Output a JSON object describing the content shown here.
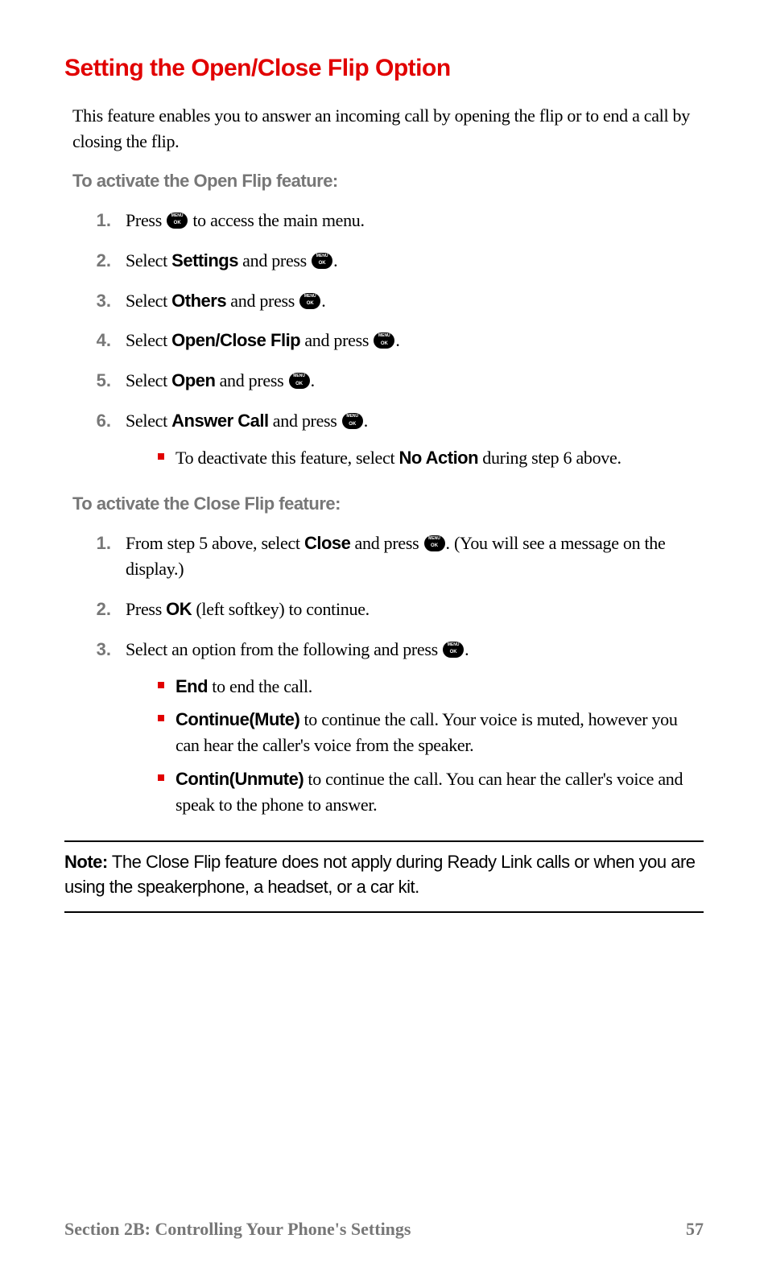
{
  "heading": "Setting the Open/Close Flip Option",
  "intro": "This feature enables you to answer an incoming call by opening the flip or to end a call by closing the flip.",
  "sub1": "To activate the Open Flip feature:",
  "steps1": {
    "s1_a": "Press ",
    "s1_b": " to access the main menu.",
    "s2_a": "Select ",
    "s2_sel": "Settings",
    "s2_b": " and press ",
    "s3_a": "Select ",
    "s3_sel": "Others",
    "s3_b": " and press ",
    "s4_a": "Select ",
    "s4_sel": "Open/Close Flip",
    "s4_b": " and press ",
    "s5_a": "Select ",
    "s5_sel": "Open",
    "s5_b": " and press ",
    "s6_a": "Select ",
    "s6_sel": "Answer Call",
    "s6_b": " and press ",
    "s6_bullet_a": "To deactivate this feature, select ",
    "s6_bullet_sel": "No Action",
    "s6_bullet_b": " during step 6 above."
  },
  "sub2": "To activate the Close Flip feature:",
  "steps2": {
    "s1_a": "From step 5 above, select ",
    "s1_sel": "Close",
    "s1_b": " and press ",
    "s1_c": ". (You will see a message on the display.)",
    "s2_a": "Press ",
    "s2_sel": "OK",
    "s2_b": " (left softkey) to continue.",
    "s3_a": "Select an option from the following and press ",
    "b1_sel": "End",
    "b1_txt": " to end the call.",
    "b2_sel": "Continue(Mute)",
    "b2_txt": " to continue the call. Your voice is muted, however you can hear the caller's voice from the speaker.",
    "b3_sel": "Contin(Unmute)",
    "b3_txt": " to continue the call. You can hear the caller's voice and speak to the phone to answer."
  },
  "note": {
    "label": "Note:",
    "text": " The Close Flip feature does not apply during Ready Link calls or when you are using the speakerphone, a headset, or a car kit."
  },
  "footer": {
    "section": "Section 2B: Controlling Your Phone's Settings",
    "page": "57"
  },
  "period": "."
}
